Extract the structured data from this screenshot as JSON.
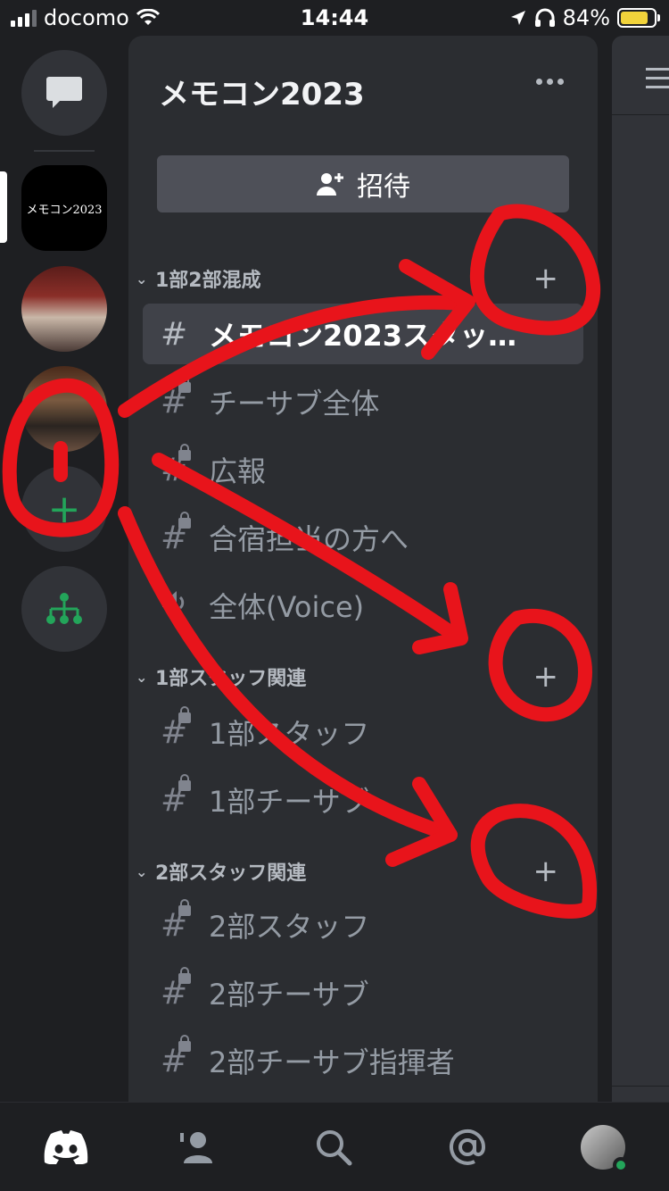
{
  "status_bar": {
    "carrier": "docomo",
    "time": "14:44",
    "battery_percent": "84%"
  },
  "server": {
    "name": "メモコン2023",
    "invite_label": "招待"
  },
  "rail": {
    "memocon_label": "メモコン2023"
  },
  "categories": [
    {
      "name": "1部2部混成",
      "channels": [
        {
          "name": "メモコン2023スタッ…",
          "type": "text",
          "locked": false,
          "selected": true
        },
        {
          "name": "チーサブ全体",
          "type": "text",
          "locked": true,
          "selected": false
        },
        {
          "name": "広報",
          "type": "text",
          "locked": true,
          "selected": false
        },
        {
          "name": "合宿担当の方へ",
          "type": "text",
          "locked": true,
          "selected": false
        },
        {
          "name": "全体(Voice)",
          "type": "voice",
          "locked": false,
          "selected": false
        }
      ]
    },
    {
      "name": "1部スタッフ関連",
      "channels": [
        {
          "name": "1部スタッフ",
          "type": "text",
          "locked": true,
          "selected": false
        },
        {
          "name": "1部チーサブ",
          "type": "text",
          "locked": true,
          "selected": false
        }
      ]
    },
    {
      "name": "2部スタッフ関連",
      "channels": [
        {
          "name": "2部スタッフ",
          "type": "text",
          "locked": true,
          "selected": false
        },
        {
          "name": "2部チーサブ",
          "type": "text",
          "locked": true,
          "selected": false
        },
        {
          "name": "2部チーサブ指揮者",
          "type": "text",
          "locked": true,
          "selected": false
        }
      ]
    }
  ],
  "tabs": [
    "home-icon",
    "friends-icon",
    "search-icon",
    "mentions-icon",
    "profile-avatar"
  ],
  "colors": {
    "background": "#1e1f22",
    "panel": "#2b2d31",
    "selected": "#404249",
    "add_server": "#23a55a",
    "annotation": "#e8141b"
  }
}
